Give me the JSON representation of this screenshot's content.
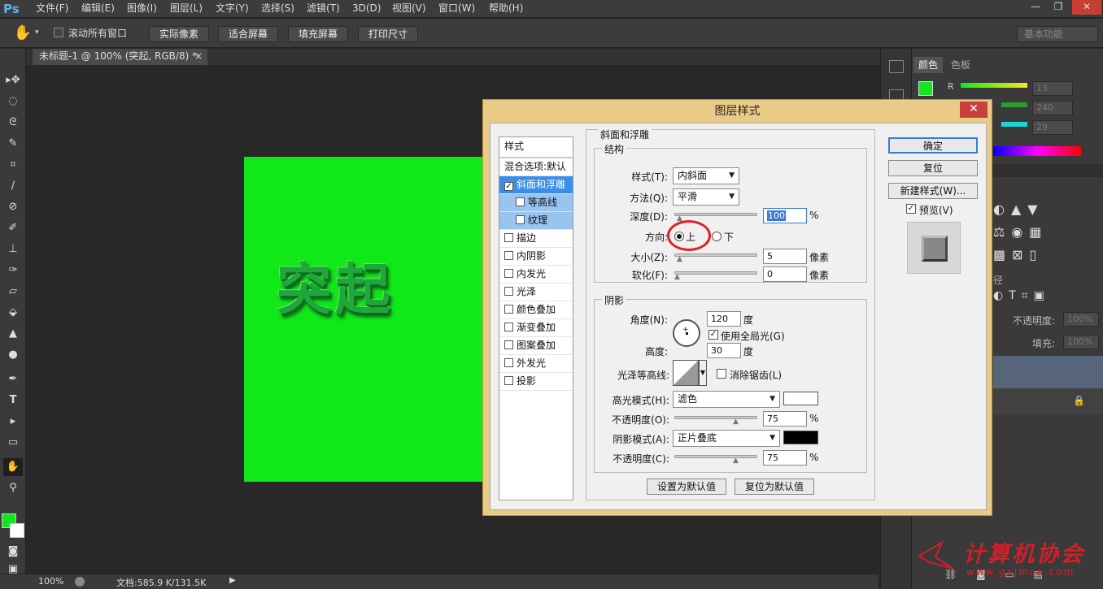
{
  "app": {
    "logo": "Ps"
  },
  "menu": [
    "文件(F)",
    "编辑(E)",
    "图像(I)",
    "图层(L)",
    "文字(Y)",
    "选择(S)",
    "滤镜(T)",
    "3D(D)",
    "视图(V)",
    "窗口(W)",
    "帮助(H)"
  ],
  "window_controls": {
    "minimize": "—",
    "restore": "❐",
    "close": "✕"
  },
  "options_bar": {
    "scroll_all": "滚动所有窗口",
    "buttons": [
      "实际像素",
      "适合屏幕",
      "填充屏幕",
      "打印尺寸"
    ],
    "workspace": "基本功能"
  },
  "document_tab": {
    "title": "未标题-1 @ 100% (突起, RGB/8) *",
    "close": "×"
  },
  "canvas": {
    "text": "突起",
    "color": "#10e818"
  },
  "status": {
    "zoom": "100%",
    "doc": "文档:585.9 K/131.5K"
  },
  "color_panel": {
    "tabs": [
      "颜色",
      "色板"
    ],
    "r_label": "R",
    "values": [
      "13",
      "240",
      "29"
    ]
  },
  "layers_panel": {
    "opacity_label": "不透明度:",
    "opacity": "100%",
    "fill_label": "填充:",
    "fill": "100%",
    "tab": "径"
  },
  "foreground_color": "#12e61d",
  "dialog": {
    "title": "图层样式",
    "close": "✕",
    "styles_header": "样式",
    "blend_options": "混合选项:默认",
    "styles": [
      {
        "label": "斜面和浮雕",
        "checked": true,
        "selected": true
      },
      {
        "label": "等高线",
        "checked": false,
        "sub": true
      },
      {
        "label": "纹理",
        "checked": false,
        "sub": true
      },
      {
        "label": "描边",
        "checked": false
      },
      {
        "label": "内阴影",
        "checked": false
      },
      {
        "label": "内发光",
        "checked": false
      },
      {
        "label": "光泽",
        "checked": false
      },
      {
        "label": "颜色叠加",
        "checked": false
      },
      {
        "label": "渐变叠加",
        "checked": false
      },
      {
        "label": "图案叠加",
        "checked": false
      },
      {
        "label": "外发光",
        "checked": false
      },
      {
        "label": "投影",
        "checked": false
      }
    ],
    "bevel": {
      "section": "斜面和浮雕",
      "structure": "结构",
      "style_label": "样式(T):",
      "style_value": "内斜面",
      "technique_label": "方法(Q):",
      "technique_value": "平滑",
      "depth_label": "深度(D):",
      "depth_value": "100",
      "depth_unit": "%",
      "direction_label": "方向:",
      "dir_up": "上",
      "dir_down": "下",
      "size_label": "大小(Z):",
      "size_value": "5",
      "size_unit": "像素",
      "soften_label": "软化(F):",
      "soften_value": "0",
      "soften_unit": "像素"
    },
    "shading": {
      "section": "阴影",
      "angle_label": "角度(N):",
      "angle_value": "120",
      "angle_unit": "度",
      "global_light": "使用全局光(G)",
      "altitude_label": "高度:",
      "altitude_value": "30",
      "altitude_unit": "度",
      "gloss_label": "光泽等高线:",
      "anti_alias": "消除锯齿(L)",
      "highlight_label": "高光模式(H):",
      "highlight_value": "滤色",
      "highlight_color": "#ffffff",
      "hl_opacity_label": "不透明度(O):",
      "hl_opacity_value": "75",
      "hl_opacity_unit": "%",
      "shadow_label": "阴影模式(A):",
      "shadow_value": "正片叠底",
      "shadow_color": "#000000",
      "sh_opacity_label": "不透明度(C):",
      "sh_opacity_value": "75",
      "sh_opacity_unit": "%"
    },
    "bottom_buttons": [
      "设置为默认值",
      "复位为默认值"
    ],
    "right_buttons": [
      "确定",
      "复位",
      "新建样式(W)..."
    ],
    "preview_label": "预览(V)"
  },
  "watermark": {
    "text": "计算机协会",
    "url": "www.gxjmca.com"
  }
}
